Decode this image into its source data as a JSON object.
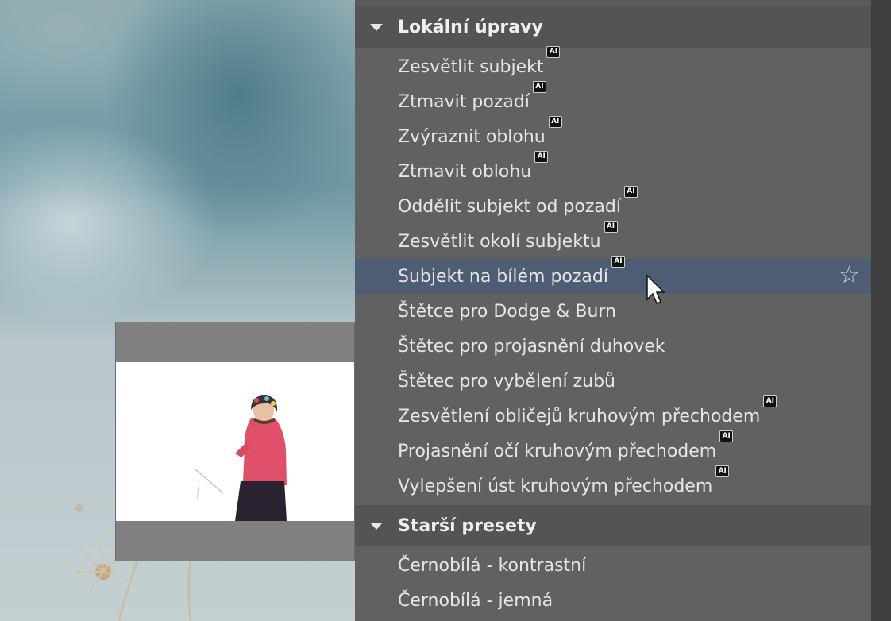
{
  "sections": [
    {
      "title": "Lokální úpravy",
      "items": [
        {
          "label": "Zesvětlit subjekt",
          "ai": true
        },
        {
          "label": "Ztmavit pozadí",
          "ai": true
        },
        {
          "label": "Zvýraznit oblohu",
          "ai": true
        },
        {
          "label": "Ztmavit oblohu",
          "ai": true
        },
        {
          "label": "Oddělit subjekt od pozadí",
          "ai": true
        },
        {
          "label": "Zesvětlit okolí subjektu",
          "ai": true
        },
        {
          "label": "Subjekt na bílém pozadí",
          "ai": true,
          "selected": true
        },
        {
          "label": "Štětce pro Dodge & Burn",
          "ai": false
        },
        {
          "label": "Štětec pro projasnění duhovek",
          "ai": false
        },
        {
          "label": "Štětec pro vybělení zubů",
          "ai": false
        },
        {
          "label": "Zesvětlení obličejů kruhovým přechodem",
          "ai": true
        },
        {
          "label": "Projasnění očí kruhovým přechodem",
          "ai": true
        },
        {
          "label": "Vylepšení úst kruhovým přechodem",
          "ai": true
        }
      ]
    },
    {
      "title": "Starší presety",
      "items": [
        {
          "label": "Černobílá - kontrastní",
          "ai": false
        },
        {
          "label": "Černobílá - jemná",
          "ai": false
        }
      ]
    }
  ],
  "badge_text": "AI",
  "icons": {
    "expand": "triangle-down-icon",
    "favorite": "star-outline-icon",
    "pointer": "mouse-cursor-icon"
  },
  "colors": {
    "panel": "#616161",
    "header": "#545454",
    "selected": "#4c5d74",
    "text": "#e6e6e6"
  }
}
